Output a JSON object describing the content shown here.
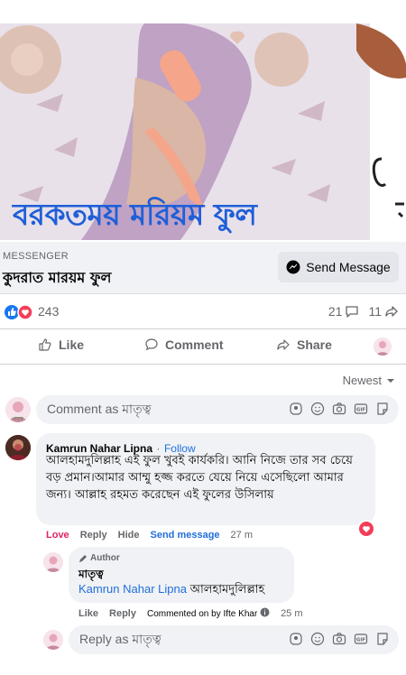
{
  "hero": {
    "title": "বরকতময় মরিয়ম ফুল"
  },
  "ad": {
    "label": "MESSENGER",
    "name": "কুদরাত মারয়ম ফুল",
    "send_label": "Send Message"
  },
  "stats": {
    "reactions": "243",
    "comments": "21",
    "shares": "11"
  },
  "actions": {
    "like": "Like",
    "comment": "Comment",
    "share": "Share"
  },
  "sort_label": "Newest",
  "composer": {
    "placeholder": "Comment as মাতৃত্ব"
  },
  "comment1": {
    "author": "Kamrun Nahar Lipna",
    "follow": "Follow",
    "text": "আলহামদুলিল্লাহ এই ফুল খুবই কার্যকরি। আনি নিজে তার সব চেয়ে বড় প্রমান।আমার আম্মু হজ্জ করতে যেয়ে নিয়ে এসেছিলো আমার জন্য। আল্লাহ রহমত করেছেন এই ফুলের উসিলায়",
    "love": "Love",
    "reply": "Reply",
    "hide": "Hide",
    "send_message": "Send message",
    "time": "27 m"
  },
  "reply1": {
    "badge": "Author",
    "author": "মাতৃত্ব",
    "mention": "Kamrun Nahar Lipna",
    "text": "আলহামদুলিল্লাহ",
    "like": "Like",
    "reply": "Reply",
    "commented_by": "Commented on by Ifte Khar",
    "time": "25 m"
  },
  "reply_composer": {
    "placeholder": "Reply as মাতৃত্ব"
  },
  "colors": {
    "accent": "#216fdb",
    "love": "#e0245e",
    "title": "#1f5fd8"
  }
}
